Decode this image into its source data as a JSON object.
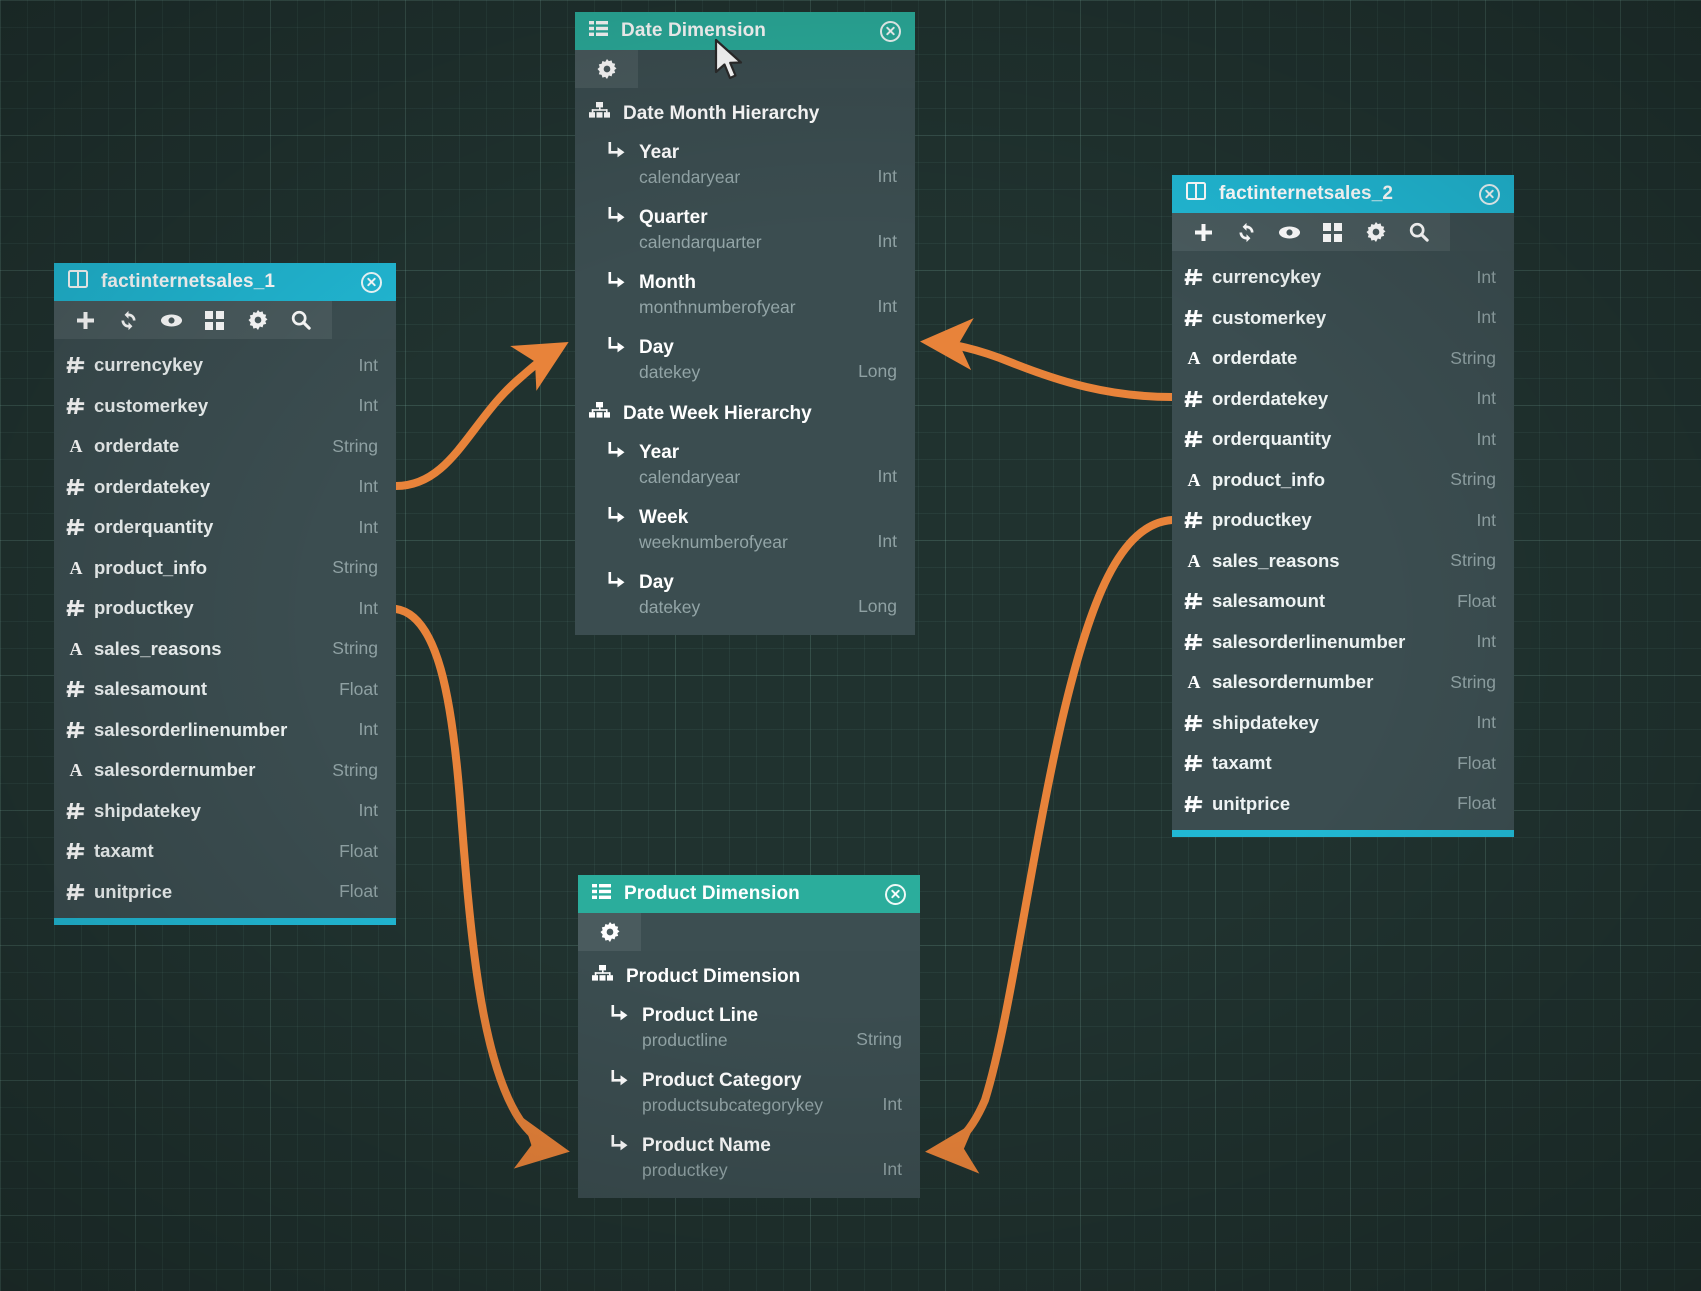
{
  "canvas": {
    "background_color": "#20322f",
    "grid_color": "#4a6b64"
  },
  "colors": {
    "fact_header": "#21b8d4",
    "dimension_header": "#2bad9c",
    "card_body": "#3b4d50",
    "toolbar": "#4a5b5e",
    "relationship_line": "#e8833a",
    "type_label": "#8fa1a3"
  },
  "toolbar_icons": [
    "plus-icon",
    "refresh-icon",
    "eye-icon",
    "grid-icon",
    "gear-icon",
    "search-icon"
  ],
  "cards": {
    "fact1": {
      "title": "factinternetsales_1",
      "title_icon": "table-icon",
      "close_label": "close",
      "fields": [
        {
          "icon": "hash-icon",
          "name": "currencykey",
          "type": "Int"
        },
        {
          "icon": "hash-icon",
          "name": "customerkey",
          "type": "Int"
        },
        {
          "icon": "letter-icon",
          "name": "orderdate",
          "type": "String"
        },
        {
          "icon": "hash-icon",
          "name": "orderdatekey",
          "type": "Int"
        },
        {
          "icon": "hash-icon",
          "name": "orderquantity",
          "type": "Int"
        },
        {
          "icon": "letter-icon",
          "name": "product_info",
          "type": "String"
        },
        {
          "icon": "hash-icon",
          "name": "productkey",
          "type": "Int"
        },
        {
          "icon": "letter-icon",
          "name": "sales_reasons",
          "type": "String"
        },
        {
          "icon": "hash-icon",
          "name": "salesamount",
          "type": "Float"
        },
        {
          "icon": "hash-icon",
          "name": "salesorderlinenumber",
          "type": "Int"
        },
        {
          "icon": "letter-icon",
          "name": "salesordernumber",
          "type": "String"
        },
        {
          "icon": "hash-icon",
          "name": "shipdatekey",
          "type": "Int"
        },
        {
          "icon": "hash-icon",
          "name": "taxamt",
          "type": "Float"
        },
        {
          "icon": "hash-icon",
          "name": "unitprice",
          "type": "Float"
        }
      ]
    },
    "fact2": {
      "title": "factinternetsales_2",
      "title_icon": "table-icon",
      "close_label": "close",
      "fields": [
        {
          "icon": "hash-icon",
          "name": "currencykey",
          "type": "Int"
        },
        {
          "icon": "hash-icon",
          "name": "customerkey",
          "type": "Int"
        },
        {
          "icon": "letter-icon",
          "name": "orderdate",
          "type": "String"
        },
        {
          "icon": "hash-icon",
          "name": "orderdatekey",
          "type": "Int"
        },
        {
          "icon": "hash-icon",
          "name": "orderquantity",
          "type": "Int"
        },
        {
          "icon": "letter-icon",
          "name": "product_info",
          "type": "String"
        },
        {
          "icon": "hash-icon",
          "name": "productkey",
          "type": "Int"
        },
        {
          "icon": "letter-icon",
          "name": "sales_reasons",
          "type": "String"
        },
        {
          "icon": "hash-icon",
          "name": "salesamount",
          "type": "Float"
        },
        {
          "icon": "hash-icon",
          "name": "salesorderlinenumber",
          "type": "Int"
        },
        {
          "icon": "letter-icon",
          "name": "salesordernumber",
          "type": "String"
        },
        {
          "icon": "hash-icon",
          "name": "shipdatekey",
          "type": "Int"
        },
        {
          "icon": "hash-icon",
          "name": "taxamt",
          "type": "Float"
        },
        {
          "icon": "hash-icon",
          "name": "unitprice",
          "type": "Float"
        }
      ]
    },
    "date_dimension": {
      "title": "Date Dimension",
      "title_icon": "list-icon",
      "close_label": "close",
      "toolbar_icons": [
        "gear-icon"
      ],
      "hierarchies": [
        {
          "name": "Date Month Hierarchy",
          "icon": "hierarchy-icon",
          "levels": [
            {
              "label": "Year",
              "field": "calendaryear",
              "type": "Int"
            },
            {
              "label": "Quarter",
              "field": "calendarquarter",
              "type": "Int"
            },
            {
              "label": "Month",
              "field": "monthnumberofyear",
              "type": "Int"
            },
            {
              "label": "Day",
              "field": "datekey",
              "type": "Long"
            }
          ]
        },
        {
          "name": "Date Week Hierarchy",
          "icon": "hierarchy-icon",
          "levels": [
            {
              "label": "Year",
              "field": "calendaryear",
              "type": "Int"
            },
            {
              "label": "Week",
              "field": "weeknumberofyear",
              "type": "Int"
            },
            {
              "label": "Day",
              "field": "datekey",
              "type": "Long"
            }
          ]
        }
      ]
    },
    "product_dimension": {
      "title": "Product Dimension",
      "title_icon": "list-icon",
      "close_label": "close",
      "toolbar_icons": [
        "gear-icon"
      ],
      "hierarchies": [
        {
          "name": "Product Dimension",
          "icon": "hierarchy-icon",
          "levels": [
            {
              "label": "Product Line",
              "field": "productline",
              "type": "String"
            },
            {
              "label": "Product Category",
              "field": "productsubcategorykey",
              "type": "Int"
            },
            {
              "label": "Product Name",
              "field": "productkey",
              "type": "Int"
            }
          ]
        }
      ]
    }
  },
  "relationships": [
    {
      "from": "factinternetsales_1.orderdatekey",
      "to": "Date Dimension.Day (datekey)"
    },
    {
      "from": "factinternetsales_2.orderdatekey",
      "to": "Date Dimension.Day (datekey)"
    },
    {
      "from": "factinternetsales_1.productkey",
      "to": "Product Dimension.Product Name"
    },
    {
      "from": "factinternetsales_2.productkey",
      "to": "Product Dimension.Product Name"
    }
  ],
  "cursor": {
    "type": "pointer-arrow"
  }
}
